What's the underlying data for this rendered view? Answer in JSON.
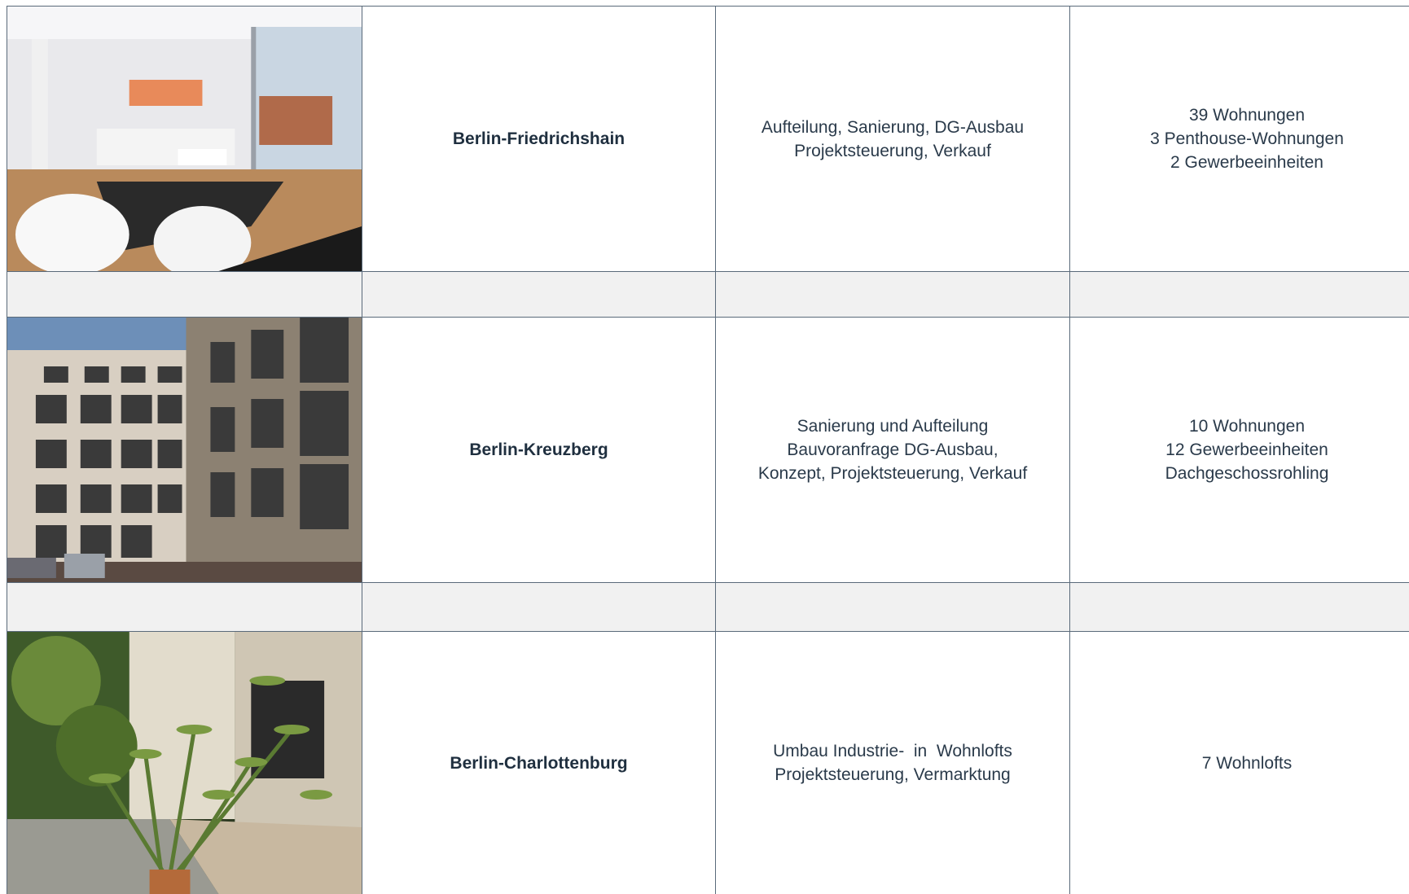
{
  "projects": [
    {
      "location": "Berlin-Friedrichshain",
      "services": [
        "Aufteilung, Sanierung, DG-Ausbau",
        "Projektsteuerung, Verkauf"
      ],
      "units": [
        "39 Wohnungen",
        "3 Penthouse-Wohnungen",
        "2 Gewerbeeinheiten"
      ],
      "image": "living-room-photo"
    },
    {
      "location": "Berlin-Kreuzberg",
      "services": [
        "Sanierung und Aufteilung",
        "Bauvoranfrage DG-Ausbau,",
        "Konzept, Projektsteuerung, Verkauf"
      ],
      "units": [
        "10 Wohnungen",
        "12 Gewerbeeinheiten",
        "Dachgeschossrohling"
      ],
      "image": "courtyard-building-photo"
    },
    {
      "location": "Berlin-Charlottenburg",
      "services": [
        "Umbau Industrie-  in  Wohnlofts",
        "Projektsteuerung, Vermarktung"
      ],
      "units": [
        "7 Wohnlofts"
      ],
      "image": "garden-courtyard-photo"
    }
  ],
  "colors": {
    "border": "#5a6a7a",
    "spacer": "#f1f1f1",
    "text": "#2a3a4a"
  }
}
